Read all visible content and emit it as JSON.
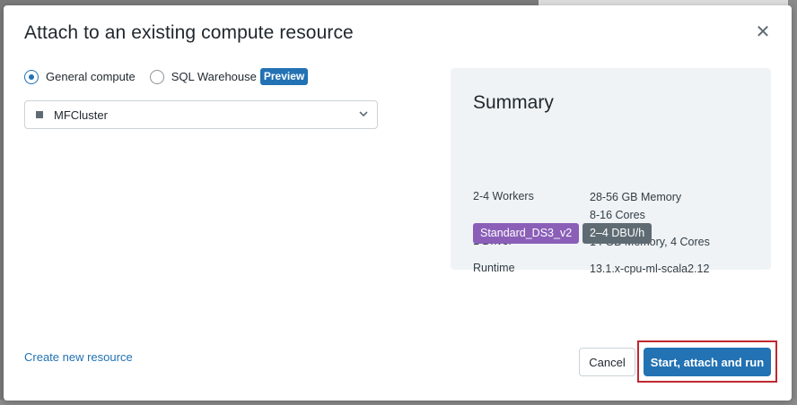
{
  "dialog": {
    "title": "Attach to an existing compute resource",
    "close_icon": "close-icon"
  },
  "compute_type": {
    "options": [
      {
        "label": "General compute",
        "selected": true
      },
      {
        "label": "SQL Warehouse",
        "selected": false,
        "badge": "Preview"
      }
    ]
  },
  "cluster_select": {
    "value": "MFCluster",
    "status_icon": "stop-icon",
    "dropdown_icon": "chevron-down-icon"
  },
  "summary": {
    "title": "Summary",
    "workers_label": "2-4 Workers",
    "workers_memory": "28-56 GB Memory",
    "workers_cores": "8-16 Cores",
    "driver_label": "1 Driver",
    "driver_value": "14 GB Memory, 4 Cores",
    "runtime_label": "Runtime",
    "runtime_value": "13.1.x-cpu-ml-scala2.12",
    "tags": [
      {
        "label": "Standard_DS3_v2",
        "color": "#8b5fb8"
      },
      {
        "label": "2–4 DBU/h",
        "color": "#5f6b73"
      }
    ]
  },
  "footer": {
    "create_link": "Create new resource",
    "cancel_label": "Cancel",
    "primary_label": "Start, attach and run"
  },
  "colors": {
    "accent": "#2272b4",
    "highlight": "#c0282f",
    "summary_bg": "#eff3f6"
  }
}
